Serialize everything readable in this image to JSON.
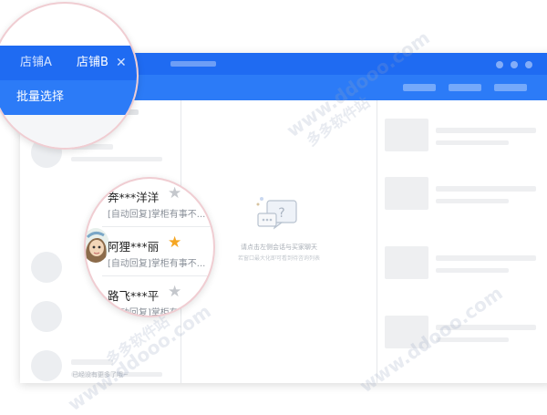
{
  "tabs": [
    {
      "label": "店铺A",
      "active": false
    },
    {
      "label": "店铺B",
      "active": true
    }
  ],
  "tab_close_icon": "close-icon",
  "toolbar": {
    "batch_select_label": "批量选择"
  },
  "contacts": [
    {
      "name": "奔***洋洋",
      "message": "[自动回复]掌柜有事不...",
      "starred": false
    },
    {
      "name": "阿狸***丽",
      "message": "[自动回复]掌柜有事不...",
      "starred": true
    },
    {
      "name": "路飞***平",
      "message": "[自动回复]掌柜有事不...",
      "starred": false
    }
  ],
  "contact_list_footer": "已经没有更多了哦~",
  "empty_chat": {
    "icon": "chat-bubbles-icon",
    "tip": "请点击左侧会话与买家聊天",
    "sub_tip": "若窗口最大化即可看到待咨询列表"
  },
  "watermark_text": "www.ddooo.com",
  "watermark_cn": "多多软件站",
  "colors": {
    "primary": "#1f6bf2",
    "toolbar": "#2c7bf7",
    "star_active": "#f5a623",
    "star_inactive": "#c4c7cc"
  }
}
